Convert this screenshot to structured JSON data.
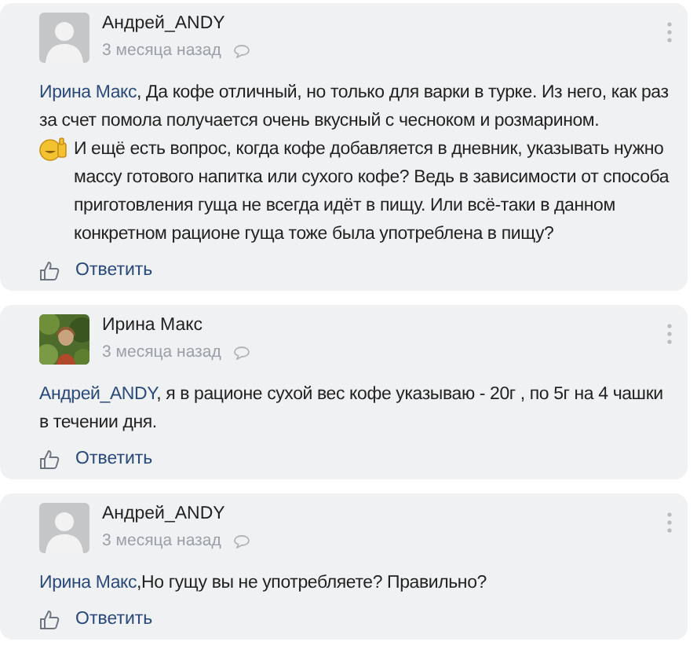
{
  "comments": [
    {
      "author": "Андрей_ANDY",
      "avatar": {
        "kind": "silhouette"
      },
      "time": "3 месяца назад",
      "mention": "Ирина Макс",
      "text": ", Да кофе отличный, но только для варки в турке. Из него, как раз за счет помола получается очень вкусный с чесноком и розмарином.",
      "emoji": true,
      "text_after_emoji": "И ещё есть вопрос, когда кофе добавляется в дневник, указывать нужно массу готового напитка или сухого кофе? Ведь в зависимости от способа приготовления  гуща не всегда идёт в пищу.  Или всё-таки в данном конкретном рационе гуща тоже была употреблена в пищу?",
      "reply": "Ответить"
    },
    {
      "author": "Ирина Макс",
      "time": "3 месяца назад",
      "mention": "Андрей_ANDY",
      "text": ", я в рационе сухой вес кофе указываю - 20г , по 5г на 4 чашки в течении дня.",
      "reply": "Ответить"
    },
    {
      "author": "Андрей_ANDY",
      "avatar": {
        "kind": "silhouette"
      },
      "time": "3 месяца назад",
      "mention": "Ирина Макс",
      "text": ",Но гущу вы не употребляете? Правильно?",
      "reply": "Ответить"
    }
  ]
}
